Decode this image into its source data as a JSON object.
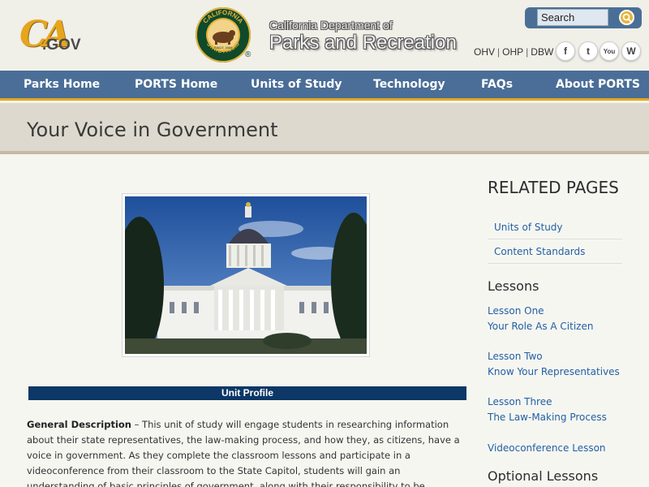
{
  "header": {
    "logo_ca": "CA",
    "logo_gov": ".GOV",
    "seal_top": "CALIFORNIA",
    "seal_bottom": "STATE PARKS",
    "seal_since": "SINCE 1864",
    "registered": "®",
    "dept_line": "California Department of",
    "dept_name": "Parks and Recreation",
    "search": {
      "value": "Search"
    },
    "util_links": [
      "OHV",
      "OHP",
      "DBW"
    ],
    "social": [
      {
        "name": "facebook-icon",
        "glyph": "f"
      },
      {
        "name": "twitter-icon",
        "glyph": "t"
      },
      {
        "name": "youtube-icon",
        "glyph": "You"
      },
      {
        "name": "wordpress-icon",
        "glyph": "W"
      }
    ]
  },
  "nav": {
    "items": [
      "Parks Home",
      "PORTS Home",
      "Units of Study",
      "Technology",
      "FAQs",
      "About PORTS"
    ]
  },
  "page": {
    "title": "Your Voice in Government",
    "unit_profile": "Unit Profile",
    "desc_label": "General Description",
    "desc_text": " – This unit of study will engage students in researching information about their state representatives, the law-making process, and how they, as citizens, have a voice in government.  As they complete the classroom lessons and participate in a videoconference from their classroom to the State Capitol, students will gain an understanding of basic principles of government, along with their responsibility to be informed citizens.  Prior to their videoconference, students will become familiar with"
  },
  "sidebar": {
    "related_title": "RELATED PAGES",
    "related_links": [
      "Units of Study",
      "Content Standards"
    ],
    "lessons_title": "Lessons",
    "lessons": [
      {
        "num": "Lesson One",
        "title": "Your Role As A Citizen"
      },
      {
        "num": "Lesson Two",
        "title": "Know Your Representatives"
      },
      {
        "num": "Lesson Three",
        "title": "The Law-Making Process"
      }
    ],
    "videoconference": "Videoconference Lesson",
    "optional_title": "Optional Lessons"
  },
  "colors": {
    "nav_bg": "#4a6e97",
    "accent_gold": "#e5a91e",
    "link_blue": "#2360a5",
    "unit_bar": "#0c3766"
  }
}
